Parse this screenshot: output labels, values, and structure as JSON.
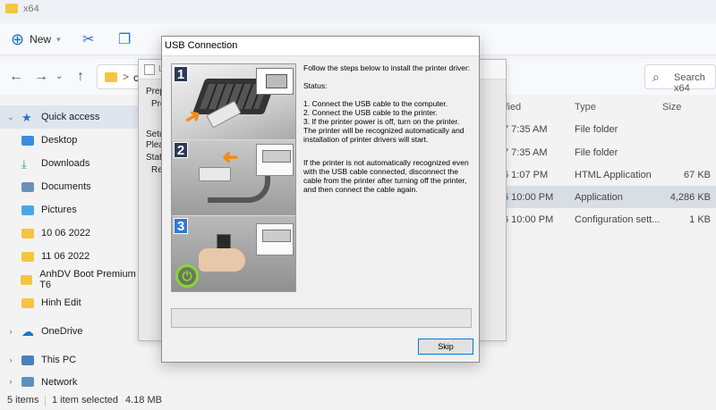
{
  "titlebar": {
    "title": "x64"
  },
  "toolbar": {
    "new_label": "New"
  },
  "address": {
    "path_fragment": "c",
    "separator": ">"
  },
  "search": {
    "placeholder": "Search x64"
  },
  "sidebar": {
    "items": [
      {
        "label": "Quick access",
        "icon": "star-icon"
      },
      {
        "label": "Desktop",
        "icon": "desktop-icon"
      },
      {
        "label": "Downloads",
        "icon": "download-icon"
      },
      {
        "label": "Documents",
        "icon": "documents-icon"
      },
      {
        "label": "Pictures",
        "icon": "pictures-icon"
      },
      {
        "label": "10 06 2022",
        "icon": "folder-icon"
      },
      {
        "label": "11 06 2022",
        "icon": "folder-icon"
      },
      {
        "label": "AnhDV Boot Premium T6",
        "icon": "folder-icon"
      },
      {
        "label": "Hinh Edit",
        "icon": "folder-icon"
      },
      {
        "label": "OneDrive",
        "icon": "cloud-icon"
      },
      {
        "label": "This PC",
        "icon": "pc-icon"
      },
      {
        "label": "Network",
        "icon": "network-icon"
      }
    ]
  },
  "filelist": {
    "headers": {
      "modified": "ified",
      "type": "Type",
      "size": "Size"
    },
    "rows": [
      {
        "modified": "7 7:35 AM",
        "type": "File folder",
        "size": ""
      },
      {
        "modified": "7 7:35 AM",
        "type": "File folder",
        "size": ""
      },
      {
        "modified": "6 1:07 PM",
        "type": "HTML Application",
        "size": "67 KB"
      },
      {
        "modified": "6 10:00 PM",
        "type": "Application",
        "size": "4,286 KB"
      },
      {
        "modified": "6 10:00 PM",
        "type": "Configuration sett...",
        "size": "1 KB"
      }
    ]
  },
  "statusbar": {
    "items_count": "5 items",
    "selection": "1 item selected",
    "size": "4.18 MB"
  },
  "setup_window": {
    "title": "Li",
    "lines": [
      "Prep",
      "Pre",
      "Setu",
      "Pleas",
      "Stat",
      "Re"
    ]
  },
  "usb_dialog": {
    "title": "USB Connection",
    "step_numbers": [
      "1",
      "2",
      "3"
    ],
    "intro": "Follow the steps below to install the printer driver:",
    "status_label": "Status:",
    "steps": [
      "1. Connect the USB cable to the computer.",
      "2. Connect the USB cable to the printer.",
      "3. If the printer power is off, turn on the printer.",
      "The printer will be recognized automatically and installation of printer drivers will start."
    ],
    "note": "If the printer is not automatically recognized even with the USB cable connected, disconnect the cable from the printer after turning off the printer, and then connect the cable again.",
    "skip_label": "Skip"
  }
}
